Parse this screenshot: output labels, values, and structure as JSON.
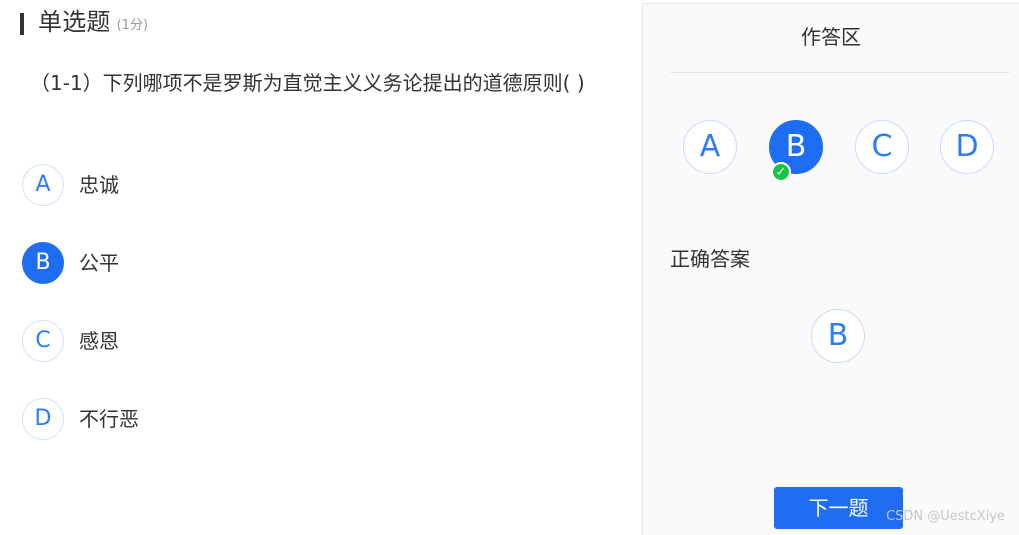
{
  "section": {
    "title": "单选题",
    "score": "(1分)"
  },
  "question": {
    "text": "（1-1）下列哪项不是罗斯为直觉主义义务论提出的道德原则(    )"
  },
  "options": [
    {
      "letter": "A",
      "text": "忠诚",
      "selected": false
    },
    {
      "letter": "B",
      "text": "公平",
      "selected": true
    },
    {
      "letter": "C",
      "text": "感恩",
      "selected": false
    },
    {
      "letter": "D",
      "text": "不行恶",
      "selected": false
    }
  ],
  "answer_panel": {
    "title": "作答区",
    "choices": [
      {
        "letter": "A",
        "selected": false
      },
      {
        "letter": "B",
        "selected": true
      },
      {
        "letter": "C",
        "selected": false
      },
      {
        "letter": "D",
        "selected": false
      }
    ],
    "correct_label": "正确答案",
    "correct_answer": "B",
    "next_button_label": "下一题",
    "selected_status_icon": "check-icon"
  },
  "watermark": {
    "text": "CSDN @UestcXiye"
  },
  "colors": {
    "primary": "#1f6df2",
    "option_text": "#2f7df6",
    "success": "#18c34a",
    "border": "#cfe0ff",
    "panel_bg": "#fafafb"
  }
}
